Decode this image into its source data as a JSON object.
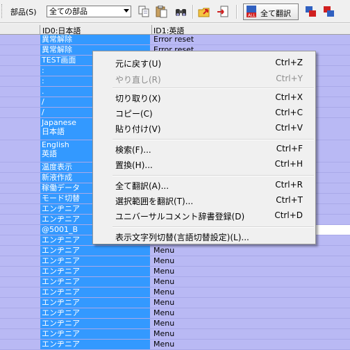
{
  "toolbar": {
    "parts_label": "部品(S)",
    "combo_value": "全ての部品",
    "translate_all_label": "全て翻訳",
    "translate_icon_text": "ALL",
    "icons": [
      "copy-icon",
      "paste-icon",
      "find-icon",
      "export-icon",
      "import-icon",
      "translate-all-icon",
      "switch-language-icon",
      "switch-language-alt-icon"
    ]
  },
  "table": {
    "headers": [
      "ID0:日本語",
      "ID1:英語"
    ],
    "rows": [
      {
        "jp": "異常解除",
        "en": "Error reset"
      },
      {
        "jp": "異常解除",
        "en": "Error reset"
      },
      {
        "jp": "TEST画面",
        "en": ""
      },
      {
        "jp": ":",
        "en": ""
      },
      {
        "jp": ":",
        "en": ""
      },
      {
        "jp": ".",
        "en": ""
      },
      {
        "jp": "/",
        "en": ""
      },
      {
        "jp": "/",
        "en": ""
      },
      {
        "jp": "Japanese\n日本語",
        "en": ""
      },
      {
        "jp": "English\n英語",
        "en": ""
      },
      {
        "jp": "温度表示",
        "en": ""
      },
      {
        "jp": "新液作成",
        "en": ""
      },
      {
        "jp": "稼働データ",
        "en": ""
      },
      {
        "jp": "モード切替",
        "en": ""
      },
      {
        "jp": "エンヂニア",
        "en": ""
      },
      {
        "jp": "エンヂニア",
        "en": ""
      },
      {
        "jp": "@5001_B",
        "en": ""
      },
      {
        "jp": "エンヂニア",
        "en": ""
      },
      {
        "jp": "エンヂニア",
        "en": "Menu"
      },
      {
        "jp": "エンヂニア",
        "en": "Menu"
      },
      {
        "jp": "エンヂニア",
        "en": "Menu"
      },
      {
        "jp": "エンヂニア",
        "en": "Menu"
      },
      {
        "jp": "エンヂニア",
        "en": "Menu"
      },
      {
        "jp": "エンヂニア",
        "en": "Menu"
      },
      {
        "jp": "エンヂニア",
        "en": "Menu"
      },
      {
        "jp": "エンヂニア",
        "en": "Menu"
      },
      {
        "jp": "エンヂニア",
        "en": "Menu"
      },
      {
        "jp": "エンヂニア",
        "en": "Menu"
      }
    ]
  },
  "context_menu": {
    "items": [
      {
        "label": "元に戻す(U)",
        "shortcut": "Ctrl+Z",
        "disabled": false
      },
      {
        "label": "やり直し(R)",
        "shortcut": "Ctrl+Y",
        "disabled": true
      },
      {
        "label": "切り取り(X)",
        "shortcut": "Ctrl+X",
        "disabled": false
      },
      {
        "label": "コピー(C)",
        "shortcut": "Ctrl+C",
        "disabled": false
      },
      {
        "label": "貼り付け(V)",
        "shortcut": "Ctrl+V",
        "disabled": false
      },
      {
        "label": "検索(F)...",
        "shortcut": "Ctrl+F",
        "disabled": false
      },
      {
        "label": "置換(H)...",
        "shortcut": "Ctrl+H",
        "disabled": false
      },
      {
        "label": "全て翻訳(A)...",
        "shortcut": "Ctrl+R",
        "disabled": false
      },
      {
        "label": "選択範囲を翻訳(T)...",
        "shortcut": "Ctrl+T",
        "disabled": false
      },
      {
        "label": "ユニバーサルコメント辞書登録(D)",
        "shortcut": "Ctrl+D",
        "disabled": false
      },
      {
        "label": "表示文字列切替(言語切替設定)(L)...",
        "shortcut": "",
        "disabled": false
      }
    ]
  },
  "colors": {
    "selection": "#3399ff",
    "row_background": "#b9b9f4"
  }
}
